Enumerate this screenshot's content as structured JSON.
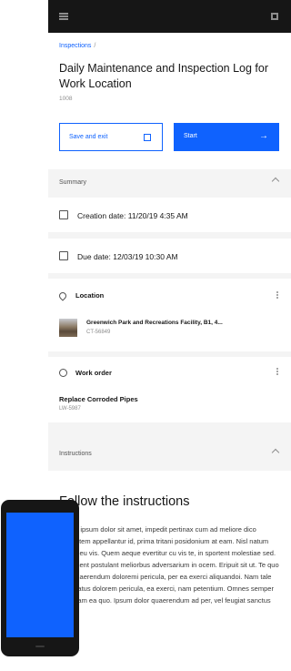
{
  "app": {
    "breadcrumb": "Inspections",
    "breadcrumb_sep": "/",
    "title": "Daily Maintenance and Inspection Log for Work Location",
    "subtitle": "1008"
  },
  "actions": {
    "save_label": "Save and exit",
    "start_label": "Start"
  },
  "summary": {
    "section_label": "Summary",
    "creation_date": "Creation date: 11/20/19  4:35 AM",
    "due_date": "Due date: 12/03/19  10:30 AM"
  },
  "location": {
    "header": "Location",
    "name": "Greenwich Park and Recreations Facility, B1, 4...",
    "id": "CT-56849"
  },
  "work_order": {
    "header": "Work order",
    "title": "Replace Corroded Pipes",
    "id": "LW-5987"
  },
  "instructions": {
    "section_label": "Instructions",
    "heading": "Follow the instructions",
    "body": "Lorem ipsum dolor sit amet, impedit pertinax cum ad meliore dico sapientem appellantur id, prima tritani posidonium at eam. Nisl natum eruditi eu vis. Quem aeque evertitur cu vis te, in sportent molestiae sed. Sit vocent postulant meliorbus adversarium in ocem. Eripuit sit ut. Te quo tale quaerendum doloremi pericula, per ea exerci aliquandoi. Nam tale nominatus dolorem pericula, ea exerci, nam petentium. Omnes semper antiopam ea quo. Ipsum dolor quaerendum ad per, vel feugiat sanctus"
  },
  "icons": {
    "menu": "hamburger-menu-icon",
    "apps": "app-switcher-icon",
    "save": "save-icon",
    "start": "arrow-right-icon",
    "calendar": "calendar-icon",
    "location": "location-pin-icon",
    "work_order": "wrench-icon",
    "overflow": "overflow-menu-icon",
    "chevron": "chevron-up-icon"
  },
  "colors": {
    "accent": "#0f62fe",
    "header": "#161616",
    "background": "#f4f4f4"
  }
}
